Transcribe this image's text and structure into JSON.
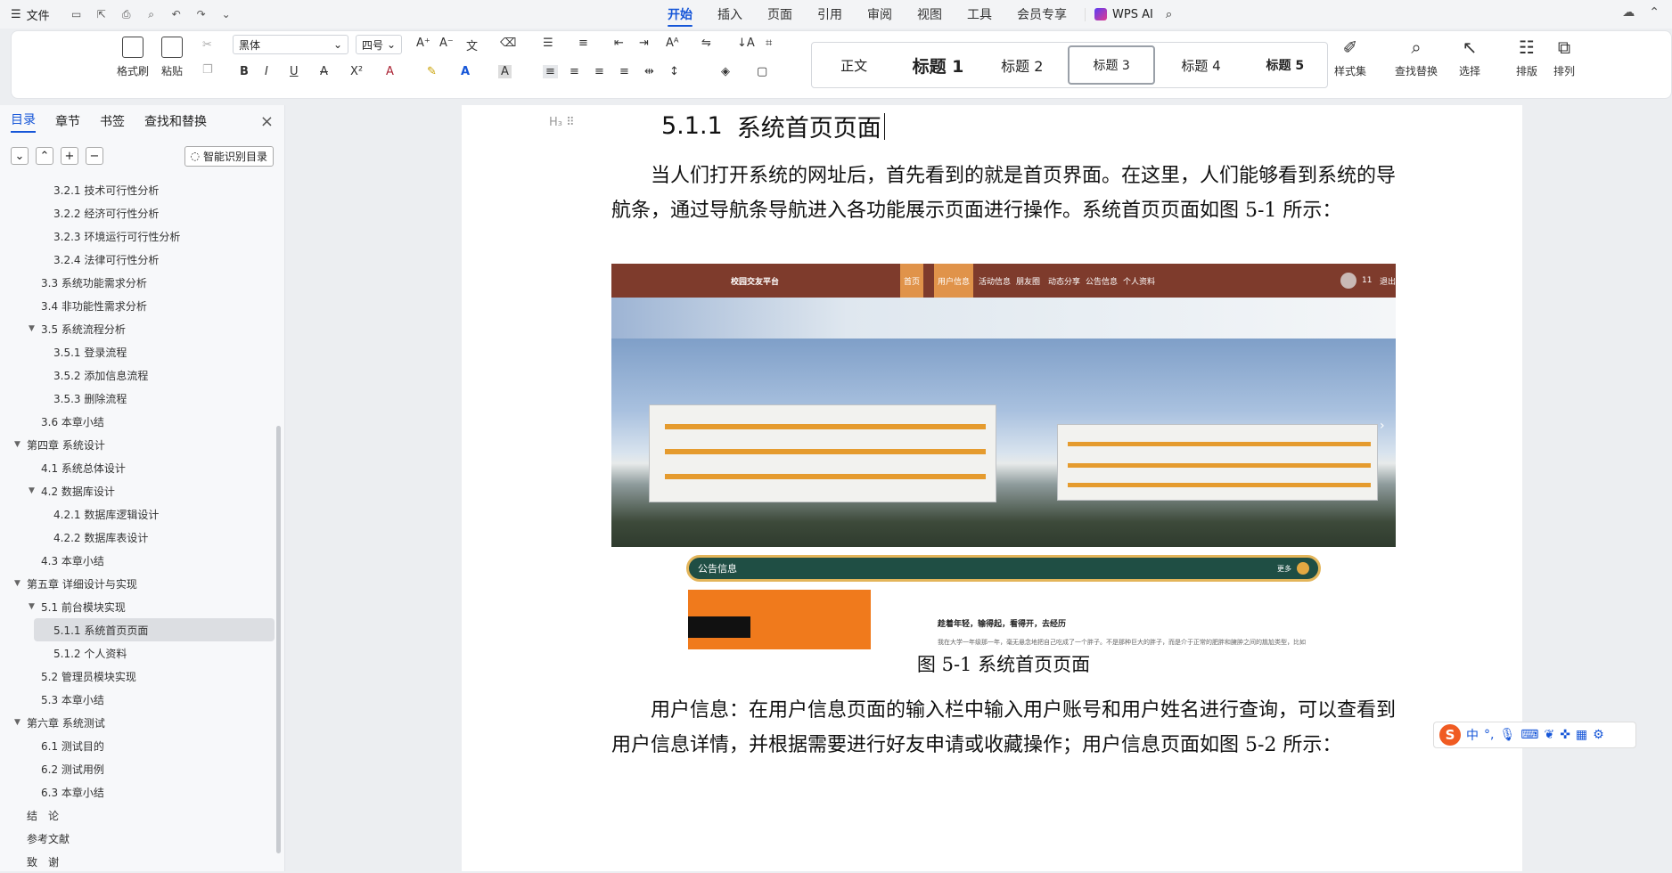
{
  "topbar": {
    "file_label": "文件",
    "menu": [
      "开始",
      "插入",
      "页面",
      "引用",
      "审阅",
      "视图",
      "工具",
      "会员专享"
    ],
    "active_menu": "开始",
    "wps_ai": "WPS AI"
  },
  "ribbon": {
    "format_painter": "格式刷",
    "paste": "粘贴",
    "font_name": "黑体",
    "font_size": "四号",
    "styles": [
      "正文",
      "标题 1",
      "标题 2",
      "标题 3",
      "标题 4",
      "标题 5"
    ],
    "style_set": "样式集",
    "find_replace": "查找替换",
    "select": "选择",
    "layout": "排版",
    "arrange": "排列"
  },
  "sidebar": {
    "tabs": [
      "目录",
      "章节",
      "书签",
      "查找和替换"
    ],
    "smart_toc": "智能识别目录",
    "toc": [
      {
        "label": "3.2.1 技术可行性分析",
        "level": 3
      },
      {
        "label": "3.2.2 经济可行性分析",
        "level": 3
      },
      {
        "label": "3.2.3 环境运行可行性分析",
        "level": 3
      },
      {
        "label": "3.2.4 法律可行性分析",
        "level": 3
      },
      {
        "label": "3.3 系统功能需求分析",
        "level": 2
      },
      {
        "label": "3.4 非功能性需求分析",
        "level": 2
      },
      {
        "label": "3.5 系统流程分析",
        "level": 2,
        "expanded": true
      },
      {
        "label": "3.5.1 登录流程",
        "level": 3
      },
      {
        "label": "3.5.2 添加信息流程",
        "level": 3
      },
      {
        "label": "3.5.3 删除流程",
        "level": 3
      },
      {
        "label": "3.6 本章小结",
        "level": 2
      },
      {
        "label": "第四章 系统设计",
        "level": 1,
        "expanded": true
      },
      {
        "label": "4.1 系统总体设计",
        "level": 2
      },
      {
        "label": "4.2 数据库设计",
        "level": 2,
        "expanded": true
      },
      {
        "label": "4.2.1 数据库逻辑设计",
        "level": 3
      },
      {
        "label": "4.2.2 数据库表设计",
        "level": 3
      },
      {
        "label": "4.3 本章小结",
        "level": 2
      },
      {
        "label": "第五章 详细设计与实现",
        "level": 1,
        "expanded": true
      },
      {
        "label": "5.1 前台模块实现",
        "level": 2,
        "expanded": true
      },
      {
        "label": "5.1.1 系统首页页面",
        "level": 3,
        "active": true
      },
      {
        "label": "5.1.2 个人资料",
        "level": 3
      },
      {
        "label": "5.2 管理员模块实现",
        "level": 2
      },
      {
        "label": "5.3 本章小结",
        "level": 2
      },
      {
        "label": "第六章 系统测试",
        "level": 1,
        "expanded": true
      },
      {
        "label": "6.1 测试目的",
        "level": 2
      },
      {
        "label": "6.2 测试用例",
        "level": 2
      },
      {
        "label": "6.3 本章小结",
        "level": 2
      },
      {
        "label": "结　论",
        "level": 1
      },
      {
        "label": "参考文献",
        "level": 1
      },
      {
        "label": "致　谢",
        "level": 1
      }
    ]
  },
  "document": {
    "heading_num": "5.1.1",
    "heading_text": "系统首页页面",
    "para1": "当人们打开系统的网址后，首先看到的就是首页界面。在这里，人们能够看到系统的导航条，通过导航条导航进入各功能展示页面进行操作。系统首页页面如图 5-1 所示：",
    "figure": {
      "site_title": "校园交友平台",
      "nav": [
        "首页",
        "用户信息",
        "活动信息",
        "朋友圈",
        "动态分享",
        "公告信息",
        "个人资料"
      ],
      "user_badge": "11",
      "logout": "退出",
      "notice_title": "公告信息",
      "more": "更多",
      "notice_headline": "趁着年轻，输得起，看得开，去经历",
      "notice_snippet": "我在大学一年级那一年，毫无悬念地把自己吃成了一个胖子。不是那种巨大的胖子，而是介于正常的肥胖和臃肿之间的尴尬类型，比如"
    },
    "caption": "图 5-1  系统首页页面",
    "para2": "用户信息：在用户信息页面的输入栏中输入用户账号和用户姓名进行查询，可以查看到用户信息详情，并根据需要进行好友申请或收藏操作；用户信息页面如图 5-2 所示："
  },
  "ime": {
    "lang": "中"
  }
}
